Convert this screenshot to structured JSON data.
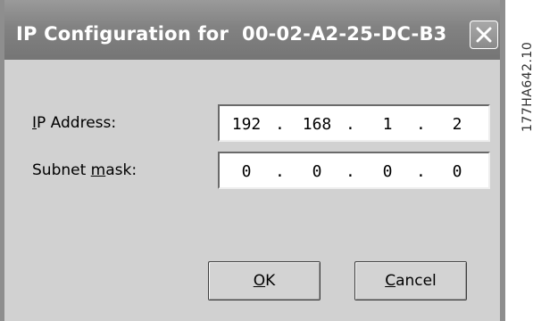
{
  "dialog": {
    "title": "IP Configuration for  00-02-A2-25-DC-B3",
    "close_icon": "close-icon"
  },
  "fields": {
    "ip_address": {
      "label_pre": "",
      "label_accel": "I",
      "label_post": "P Address:",
      "octets": [
        "192",
        "168",
        "1",
        "2"
      ]
    },
    "subnet_mask": {
      "label_pre": "Subnet ",
      "label_accel": "m",
      "label_post": "ask:",
      "octets": [
        "0",
        "0",
        "0",
        "0"
      ]
    },
    "separator": "."
  },
  "buttons": {
    "ok": {
      "accel": "O",
      "rest": "K"
    },
    "cancel": {
      "accel": "C",
      "rest": "ancel"
    }
  },
  "figure_code": "177HA642.10",
  "colors": {
    "titlebar": "#828282",
    "dialog_bg": "#d1d1d1",
    "field_bg": "#ffffff"
  }
}
